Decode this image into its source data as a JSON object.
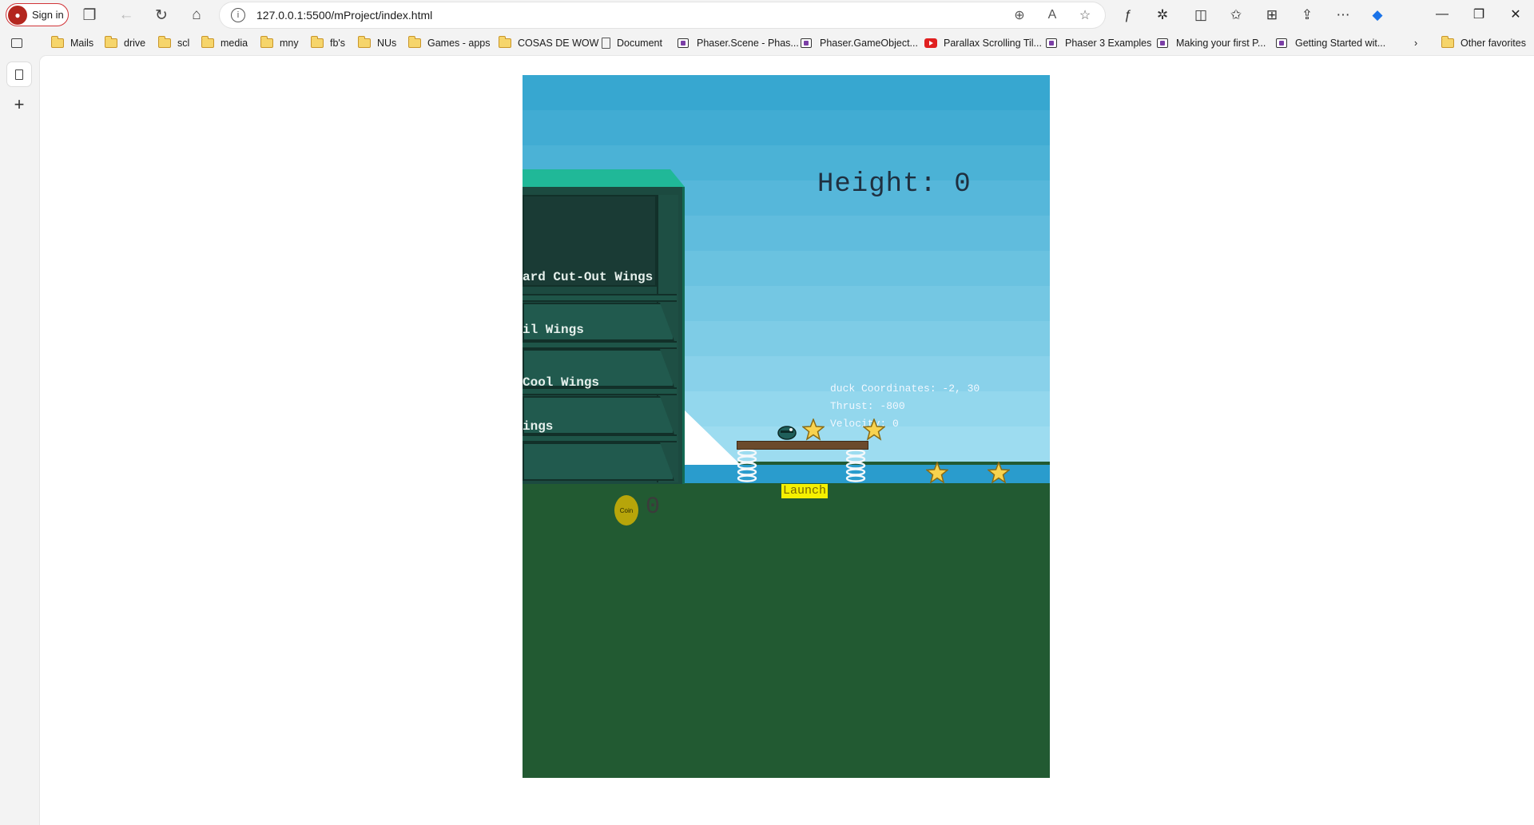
{
  "browser": {
    "profile_label": "Sign in",
    "url": "127.0.0.1:5500/mProject/index.html"
  },
  "favorites": [
    {
      "label": "Mails",
      "icon": "folder-icon"
    },
    {
      "label": "drive",
      "icon": "folder-icon"
    },
    {
      "label": "scl",
      "icon": "folder-icon"
    },
    {
      "label": "media",
      "icon": "folder-icon"
    },
    {
      "label": "mny",
      "icon": "folder-icon"
    },
    {
      "label": "fb's",
      "icon": "folder-icon"
    },
    {
      "label": "NUs",
      "icon": "folder-icon"
    },
    {
      "label": "Games - apps",
      "icon": "folder-icon"
    },
    {
      "label": "COSAS DE WOW",
      "icon": "folder-icon"
    },
    {
      "label": "Document",
      "icon": "page-icon"
    },
    {
      "label": "Phaser.Scene - Phas...",
      "icon": "phaser-icon"
    },
    {
      "label": "Phaser.GameObject...",
      "icon": "phaser-icon"
    },
    {
      "label": "Parallax Scrolling Til...",
      "icon": "youtube-icon"
    },
    {
      "label": "Phaser 3 Examples",
      "icon": "phaser-icon"
    },
    {
      "label": "Making your first P...",
      "icon": "phaser-icon"
    },
    {
      "label": "Getting Started wit...",
      "icon": "phaser-icon"
    }
  ],
  "other_favorites": "Other favorites",
  "game": {
    "height_label": "Height: 0",
    "debug_coords": "duck Coordinates: -2, 30",
    "debug_thrust": "Thrust: -800",
    "debug_velocity": "Velocity: 0",
    "launch_label": "Launch",
    "coin_label": "Coin",
    "coin_count": "0",
    "shop_items": [
      "ard Cut-Out Wings",
      "il Wings",
      "Cool Wings",
      "ings"
    ],
    "colors": {
      "sky_top": "#37a7d0",
      "sky_bottom": "#9ddcf0",
      "water": "#2a9ccd",
      "ground": "#225a32",
      "launch_bg": "#f5f000"
    }
  }
}
